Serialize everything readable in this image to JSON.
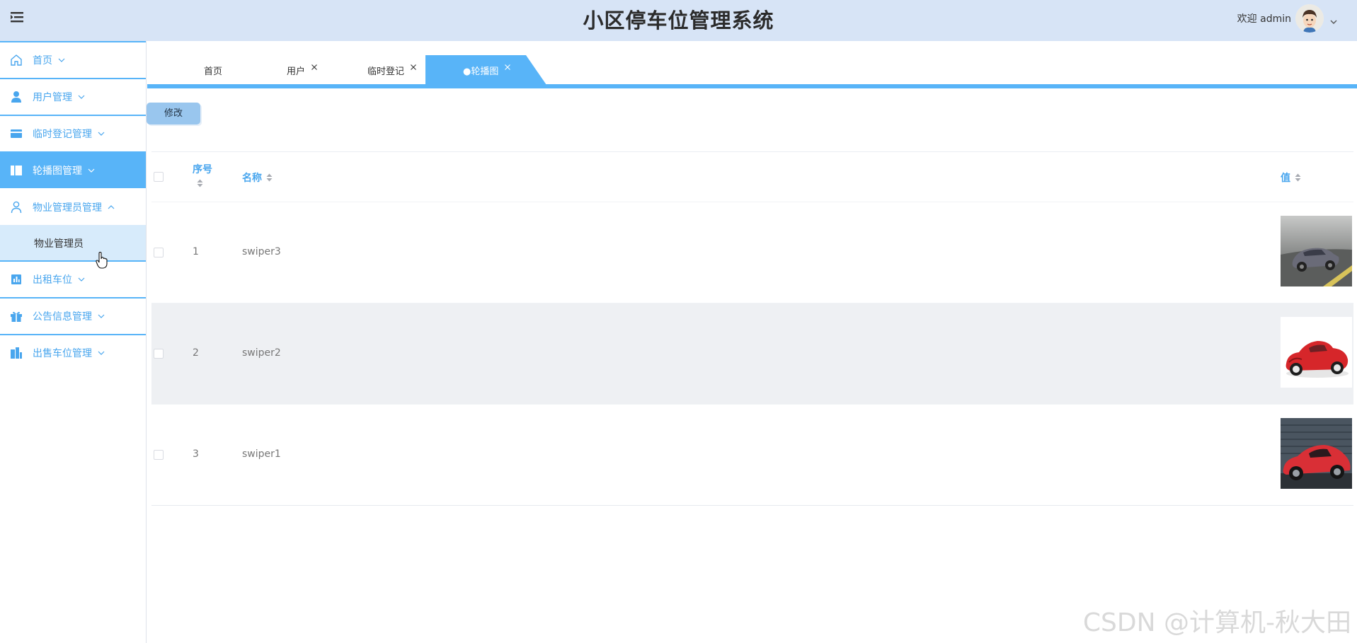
{
  "header": {
    "title": "小区停车位管理系统",
    "welcome": "欢迎 admin"
  },
  "sidebar": {
    "items": [
      {
        "label": "首页",
        "icon": "home-icon"
      },
      {
        "label": "用户管理",
        "icon": "user-icon"
      },
      {
        "label": "临时登记管理",
        "icon": "card-icon"
      },
      {
        "label": "轮播图管理",
        "icon": "layout-icon",
        "active": true
      },
      {
        "label": "物业管理员管理",
        "icon": "person-outline-icon",
        "expanded": true
      },
      {
        "label": "出租车位",
        "icon": "chart-icon"
      },
      {
        "label": "公告信息管理",
        "icon": "gift-icon"
      },
      {
        "label": "出售车位管理",
        "icon": "building-icon"
      }
    ],
    "sub_items": [
      {
        "label": "物业管理员"
      }
    ]
  },
  "tabs": [
    {
      "label": "首页",
      "closable": false
    },
    {
      "label": "用户",
      "closable": true
    },
    {
      "label": "临时登记",
      "closable": true
    },
    {
      "label": "●轮播图",
      "closable": true,
      "active": true
    }
  ],
  "toolbar": {
    "edit_label": "修改"
  },
  "table": {
    "columns": [
      "序号",
      "名称",
      "值"
    ],
    "rows": [
      {
        "index": "1",
        "name": "swiper3",
        "image": "grey sports car on wet road"
      },
      {
        "index": "2",
        "name": "swiper2",
        "image": "red vintage car on white"
      },
      {
        "index": "3",
        "name": "swiper1",
        "image": "red sports car in garage"
      }
    ]
  },
  "watermark": "CSDN @计算机-秋大田",
  "colors": {
    "header_bg": "#d7e4f6",
    "accent": "#58b4f8",
    "accent_text": "#49a6ee",
    "submenu_bg": "#d7ebfb",
    "stripe_row": "#eef0f3"
  }
}
